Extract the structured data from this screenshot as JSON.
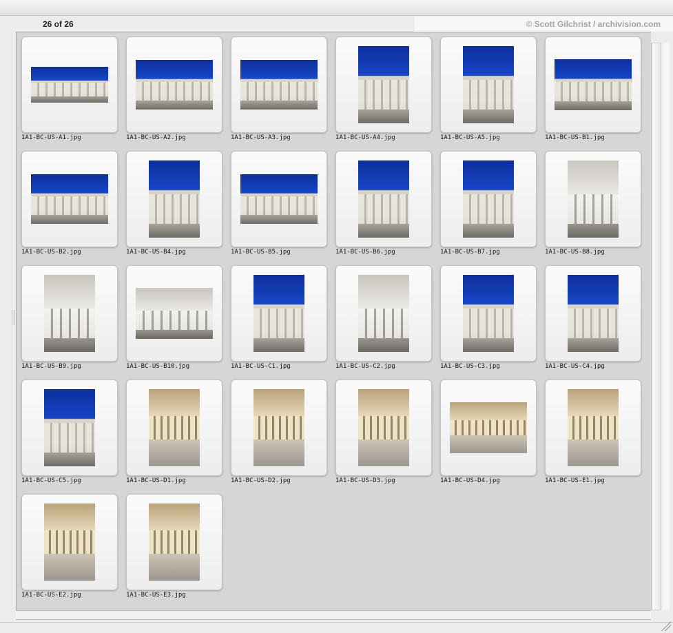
{
  "header": {
    "counter": "26 of 26",
    "credit": "© Scott Gilchrist / archivision.com"
  },
  "images": [
    {
      "file": "1A1-BC-US-A1.jpg",
      "orientation": "landscape",
      "style": "exterior"
    },
    {
      "file": "1A1-BC-US-A2.jpg",
      "orientation": "landscape",
      "style": "exterior"
    },
    {
      "file": "1A1-BC-US-A3.jpg",
      "orientation": "landscape",
      "style": "exterior"
    },
    {
      "file": "1A1-BC-US-A4.jpg",
      "orientation": "portrait",
      "style": "exterior"
    },
    {
      "file": "1A1-BC-US-A5.jpg",
      "orientation": "portrait",
      "style": "exterior"
    },
    {
      "file": "1A1-BC-US-B1.jpg",
      "orientation": "landscape",
      "style": "exterior"
    },
    {
      "file": "1A1-BC-US-B2.jpg",
      "orientation": "landscape",
      "style": "exterior"
    },
    {
      "file": "1A1-BC-US-B4.jpg",
      "orientation": "portrait",
      "style": "exterior"
    },
    {
      "file": "1A1-BC-US-B5.jpg",
      "orientation": "landscape",
      "style": "exterior"
    },
    {
      "file": "1A1-BC-US-B6.jpg",
      "orientation": "portrait",
      "style": "exterior"
    },
    {
      "file": "1A1-BC-US-B7.jpg",
      "orientation": "portrait",
      "style": "exterior"
    },
    {
      "file": "1A1-BC-US-B8.jpg",
      "orientation": "portrait",
      "style": "hall"
    },
    {
      "file": "1A1-BC-US-B9.jpg",
      "orientation": "portrait",
      "style": "hall"
    },
    {
      "file": "1A1-BC-US-B10.jpg",
      "orientation": "landscape",
      "style": "hall"
    },
    {
      "file": "1A1-BC-US-C1.jpg",
      "orientation": "portrait",
      "style": "exterior"
    },
    {
      "file": "1A1-BC-US-C2.jpg",
      "orientation": "portrait",
      "style": "hall"
    },
    {
      "file": "1A1-BC-US-C3.jpg",
      "orientation": "portrait",
      "style": "exterior"
    },
    {
      "file": "1A1-BC-US-C4.jpg",
      "orientation": "portrait",
      "style": "exterior"
    },
    {
      "file": "1A1-BC-US-C5.jpg",
      "orientation": "portrait",
      "style": "exterior"
    },
    {
      "file": "1A1-BC-US-D1.jpg",
      "orientation": "portrait",
      "style": "interior"
    },
    {
      "file": "1A1-BC-US-D2.jpg",
      "orientation": "portrait",
      "style": "interior"
    },
    {
      "file": "1A1-BC-US-D3.jpg",
      "orientation": "portrait",
      "style": "interior"
    },
    {
      "file": "1A1-BC-US-D4.jpg",
      "orientation": "landscape",
      "style": "interior"
    },
    {
      "file": "1A1-BC-US-E1.jpg",
      "orientation": "portrait",
      "style": "interior"
    },
    {
      "file": "1A1-BC-US-E2.jpg",
      "orientation": "portrait",
      "style": "interior"
    },
    {
      "file": "1A1-BC-US-E3.jpg",
      "orientation": "portrait",
      "style": "interior"
    }
  ]
}
